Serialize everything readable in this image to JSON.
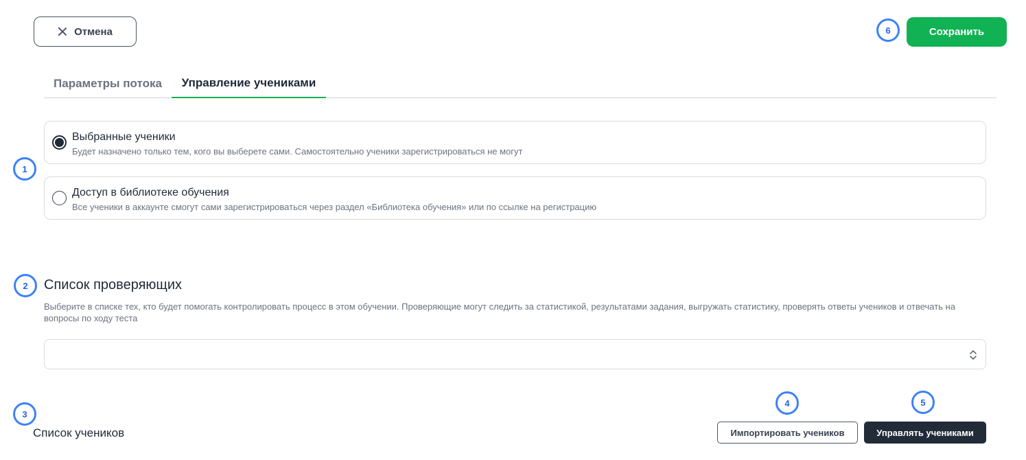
{
  "toolbar": {
    "cancel_label": "Отмена",
    "save_label": "Сохранить"
  },
  "markers": [
    "1",
    "2",
    "3",
    "4",
    "5",
    "6"
  ],
  "tabs": [
    {
      "label": "Параметры потока",
      "active": false
    },
    {
      "label": "Управление учениками",
      "active": true
    }
  ],
  "access_options": [
    {
      "title": "Выбранные ученики",
      "description": "Будет назначено только тем, кого вы выберете сами. Самостоятельно ученики зарегистрироваться не могут",
      "selected": true
    },
    {
      "title": "Доступ в библиотеке обучения",
      "description": "Все ученики в аккаунте смогут сами зарегистрироваться через раздел «Библиотека обучения» или по ссылке на регистрацию",
      "selected": false
    }
  ],
  "reviewers": {
    "title": "Список проверяющих",
    "description": "Выберите в списке тех, кто будет помогать контролировать процесс в этом обучении. Проверяющие могут следить за статистикой, результатами задания, выгружать статистику, проверять ответы учеников и отвечать на вопросы по ходу теста",
    "select_value": ""
  },
  "students": {
    "title": "Список учеников",
    "import_label": "Импортировать учеников",
    "manage_label": "Управлять учениками"
  },
  "colors": {
    "accent": "#10b253",
    "marker": "#3b82f6",
    "dark_button": "#222b38"
  }
}
